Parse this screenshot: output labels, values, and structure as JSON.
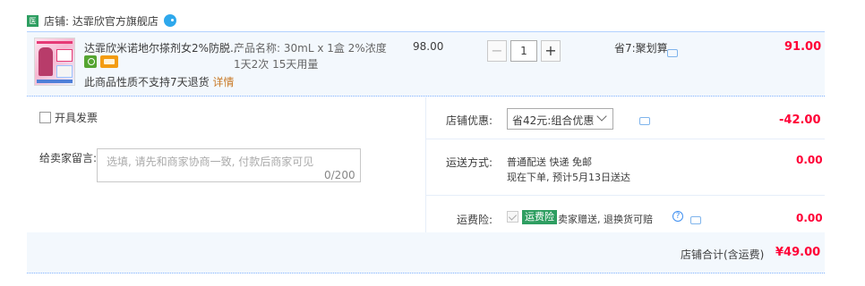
{
  "store": {
    "badge": "医",
    "name": "店铺: 达霏欣官方旗舰店"
  },
  "item": {
    "title": "达霏欣米诺地尔搽剂女2%防脱...",
    "spec_line1": "产品名称: 30mL x 1盒 2%浓度",
    "spec_line2": "1天2次 15天用量",
    "notice": "此商品性质不支持7天退货",
    "notice_link": "详情",
    "unit_price": "98.00",
    "quantity": "1",
    "promo": "省7:聚划算",
    "total": "91.00"
  },
  "left": {
    "invoice_label": "开具发票",
    "memo_label": "给卖家留言:",
    "memo_placeholder": "选填, 请先和商家协商一致, 付款后商家可见",
    "memo_count": "0/200"
  },
  "shop_promo": {
    "label": "店铺优惠:",
    "selected": "省42元:组合优惠",
    "amount": "-42.00"
  },
  "shipping": {
    "label": "运送方式:",
    "line1": "普通配送 快递 免邮",
    "line2": "现在下单, 预计5月13日送达",
    "fee": "0.00"
  },
  "insurance": {
    "label": "运费险:",
    "badge": "运费险",
    "text": "卖家赠送, 退换货可赔",
    "fee": "0.00"
  },
  "summary": {
    "label": "店铺合计(含运费)",
    "amount": "¥49.00"
  }
}
